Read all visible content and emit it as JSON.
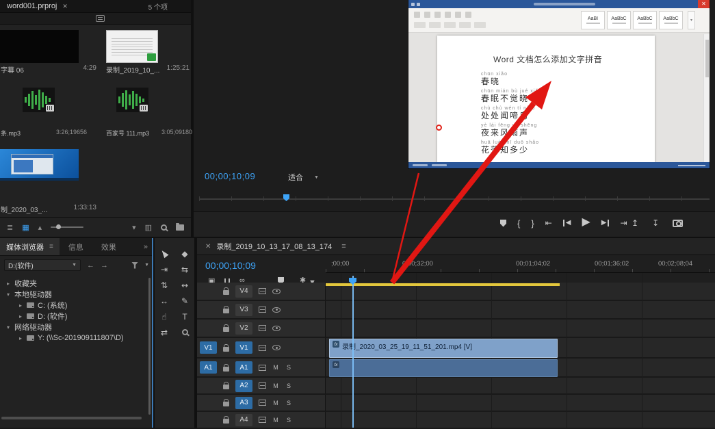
{
  "icons": {
    "close": "✕",
    "panel_menu": "≡",
    "list_view": "≣",
    "grid_view": "▦",
    "caret_up": "▴",
    "caret_down": "▾",
    "chevron_right": "▸",
    "chevron_down": "▾",
    "double_chevron": "»",
    "dropdown": "▼",
    "back": "←",
    "forward": "→",
    "mark_in": "{",
    "mark_out": "}",
    "go_to_in": "⇤",
    "go_to_out": "⇥",
    "step_back": "◀",
    "step_forward": "▶",
    "play": "▶",
    "lift": "↥",
    "extract": "↧",
    "link": "∞",
    "nest": "▣",
    "settings": "✱",
    "razor": "◆",
    "track_select": "⇥",
    "ripple": "⇆",
    "rolling": "⇅",
    "slide": "↭",
    "slip": "↔",
    "pen": "✎",
    "hand": "☝",
    "type": "T",
    "rate": "⇄",
    "strip": "▥"
  },
  "project_panel": {
    "title": "word001.prproj",
    "item_count_label": "5 个项",
    "items": [
      {
        "name": "字幕 06",
        "duration": "4:29"
      },
      {
        "name": "录制_2019_10_...",
        "duration": "1:25:21"
      },
      {
        "name": "条.mp3",
        "duration": "3:26;19656"
      },
      {
        "name": "百家号 111.mp3",
        "duration": "3:05;09180"
      },
      {
        "name": "制_2020_03_...",
        "duration": "1:33:13"
      }
    ]
  },
  "monitor": {
    "timecode": "00;00;10;09",
    "fit_label": "适合",
    "word": {
      "heading": "Word 文档怎么添加文字拼音",
      "ribbon_styles": [
        "AaBI",
        "AaBbC",
        "AaBbC",
        "AaBbC"
      ],
      "poem": [
        {
          "pinyin": "chūn xiǎo",
          "text": "春晓"
        },
        {
          "pinyin": "chūn mián bù jué xiǎo",
          "text": "春眠不觉晓"
        },
        {
          "pinyin": "chù chù wén tí niǎo",
          "text": "处处闻啼鸟"
        },
        {
          "pinyin": "yè lái fēng yǔ shēng",
          "text": "夜来风雨声"
        },
        {
          "pinyin": "huā luò zhī duō shǎo",
          "text": "花落知多少"
        }
      ]
    }
  },
  "media_browser": {
    "tabs": [
      {
        "label": "媒体浏览器"
      },
      {
        "label": "信息"
      },
      {
        "label": "效果"
      }
    ],
    "drive_dropdown": "D:(软件)",
    "tree": [
      {
        "label": "收藏夹"
      },
      {
        "label": "本地驱动器"
      },
      {
        "label": "C: (系统)"
      },
      {
        "label": "D: (软件)"
      },
      {
        "label": "网络驱动器"
      },
      {
        "label": "Y: (\\\\Sc-201909111807\\D)"
      }
    ]
  },
  "timeline": {
    "sequence_name": "录制_2019_10_13_17_08_13_174",
    "timecode": "00;00;10;09",
    "ruler": [
      ";00;00",
      "0;00;32;00",
      "00;01;04;02",
      "00;01;36;02",
      "00;02;08;04"
    ],
    "video_tracks": [
      "V4",
      "V3",
      "V2",
      "V1"
    ],
    "audio_tracks": [
      "A1",
      "A2",
      "A3",
      "A4"
    ],
    "source_patch_video": "V1",
    "source_patch_audio": "A1",
    "mute_label": "M",
    "solo_label": "S",
    "fx_label": "fx",
    "v1_clip_label": "录制_2020_03_25_19_11_51_201.mp4 [V]"
  },
  "colors": {
    "accent_blue": "#3ea4f8",
    "target_blue": "#2d6ca5",
    "clip_video": "#7fa1c9",
    "clip_audio": "#4b6d97",
    "work_area_yellow": "#e3c73c",
    "annotation_red": "#e11713",
    "word_blue": "#2b579a"
  }
}
